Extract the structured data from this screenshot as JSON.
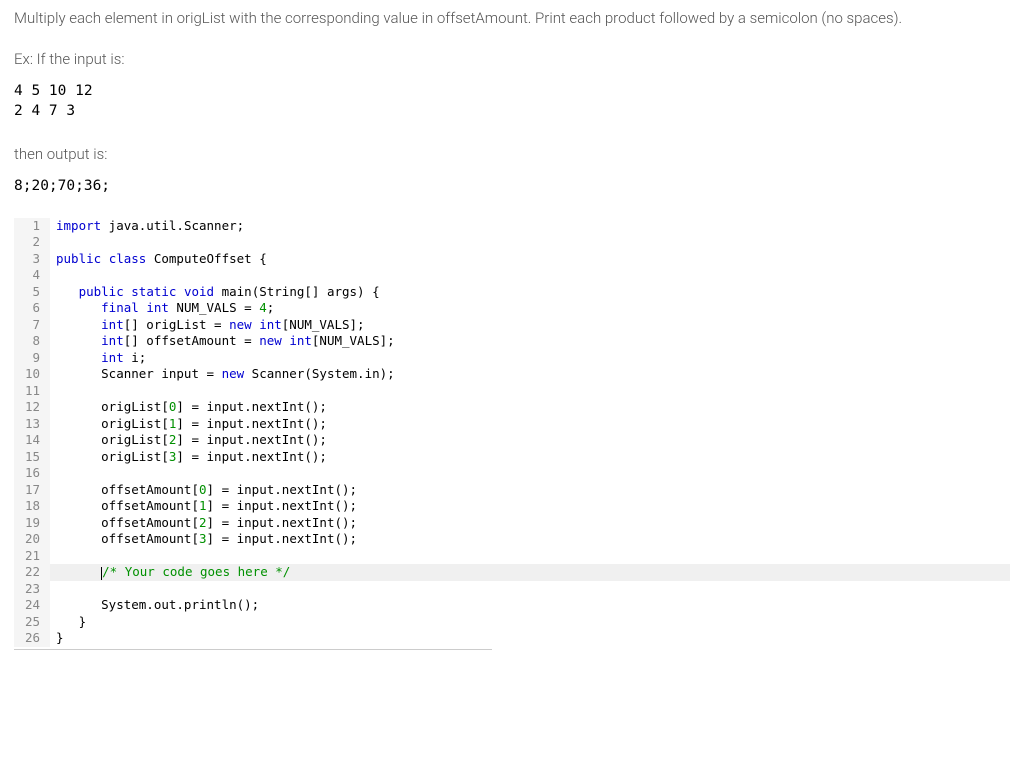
{
  "problem": {
    "instruction": "Multiply each element in origList with the corresponding value in offsetAmount. Print each product followed by a semicolon (no spaces).",
    "input_label": "Ex: If the input is:",
    "input_example": "4 5 10 12\n2 4 7 3",
    "output_label": "then output is:",
    "output_example": "8;20;70;36;"
  },
  "code": {
    "lines": [
      {
        "n": 1,
        "segments": [
          {
            "t": "import",
            "c": "kw"
          },
          {
            "t": " java.util.Scanner;",
            "c": "pkg"
          }
        ]
      },
      {
        "n": 2,
        "segments": []
      },
      {
        "n": 3,
        "segments": [
          {
            "t": "public",
            "c": "kw"
          },
          {
            "t": " ",
            "c": ""
          },
          {
            "t": "class",
            "c": "kw"
          },
          {
            "t": " ComputeOffset {",
            "c": "cls"
          }
        ]
      },
      {
        "n": 4,
        "segments": []
      },
      {
        "n": 5,
        "segments": [
          {
            "t": "   ",
            "c": ""
          },
          {
            "t": "public",
            "c": "kw"
          },
          {
            "t": " ",
            "c": ""
          },
          {
            "t": "static",
            "c": "kw"
          },
          {
            "t": " ",
            "c": ""
          },
          {
            "t": "void",
            "c": "kw"
          },
          {
            "t": " main(String[] args) {",
            "c": "method"
          }
        ]
      },
      {
        "n": 6,
        "segments": [
          {
            "t": "      ",
            "c": ""
          },
          {
            "t": "final",
            "c": "kw"
          },
          {
            "t": " ",
            "c": ""
          },
          {
            "t": "int",
            "c": "kw"
          },
          {
            "t": " NUM_VALS = ",
            "c": "var"
          },
          {
            "t": "4",
            "c": "num"
          },
          {
            "t": ";",
            "c": "punc"
          }
        ]
      },
      {
        "n": 7,
        "segments": [
          {
            "t": "      ",
            "c": ""
          },
          {
            "t": "int",
            "c": "kw"
          },
          {
            "t": "[] origList = ",
            "c": "var"
          },
          {
            "t": "new",
            "c": "kw"
          },
          {
            "t": " ",
            "c": ""
          },
          {
            "t": "int",
            "c": "kw"
          },
          {
            "t": "[NUM_VALS];",
            "c": "var"
          }
        ]
      },
      {
        "n": 8,
        "segments": [
          {
            "t": "      ",
            "c": ""
          },
          {
            "t": "int",
            "c": "kw"
          },
          {
            "t": "[] offsetAmount = ",
            "c": "var"
          },
          {
            "t": "new",
            "c": "kw"
          },
          {
            "t": " ",
            "c": ""
          },
          {
            "t": "int",
            "c": "kw"
          },
          {
            "t": "[NUM_VALS];",
            "c": "var"
          }
        ]
      },
      {
        "n": 9,
        "segments": [
          {
            "t": "      ",
            "c": ""
          },
          {
            "t": "int",
            "c": "kw"
          },
          {
            "t": " i;",
            "c": "var"
          }
        ]
      },
      {
        "n": 10,
        "segments": [
          {
            "t": "      Scanner input = ",
            "c": "var"
          },
          {
            "t": "new",
            "c": "kw"
          },
          {
            "t": " Scanner(System.in);",
            "c": "var"
          }
        ]
      },
      {
        "n": 11,
        "segments": []
      },
      {
        "n": 12,
        "segments": [
          {
            "t": "      origList[",
            "c": "var"
          },
          {
            "t": "0",
            "c": "num"
          },
          {
            "t": "] = input.nextInt();",
            "c": "var"
          }
        ]
      },
      {
        "n": 13,
        "segments": [
          {
            "t": "      origList[",
            "c": "var"
          },
          {
            "t": "1",
            "c": "num"
          },
          {
            "t": "] = input.nextInt();",
            "c": "var"
          }
        ]
      },
      {
        "n": 14,
        "segments": [
          {
            "t": "      origList[",
            "c": "var"
          },
          {
            "t": "2",
            "c": "num"
          },
          {
            "t": "] = input.nextInt();",
            "c": "var"
          }
        ]
      },
      {
        "n": 15,
        "segments": [
          {
            "t": "      origList[",
            "c": "var"
          },
          {
            "t": "3",
            "c": "num"
          },
          {
            "t": "] = input.nextInt();",
            "c": "var"
          }
        ]
      },
      {
        "n": 16,
        "segments": []
      },
      {
        "n": 17,
        "segments": [
          {
            "t": "      offsetAmount[",
            "c": "var"
          },
          {
            "t": "0",
            "c": "num"
          },
          {
            "t": "] = input.nextInt();",
            "c": "var"
          }
        ]
      },
      {
        "n": 18,
        "segments": [
          {
            "t": "      offsetAmount[",
            "c": "var"
          },
          {
            "t": "1",
            "c": "num"
          },
          {
            "t": "] = input.nextInt();",
            "c": "var"
          }
        ]
      },
      {
        "n": 19,
        "segments": [
          {
            "t": "      offsetAmount[",
            "c": "var"
          },
          {
            "t": "2",
            "c": "num"
          },
          {
            "t": "] = input.nextInt();",
            "c": "var"
          }
        ]
      },
      {
        "n": 20,
        "segments": [
          {
            "t": "      offsetAmount[",
            "c": "var"
          },
          {
            "t": "3",
            "c": "num"
          },
          {
            "t": "] = input.nextInt();",
            "c": "var"
          }
        ]
      },
      {
        "n": 21,
        "segments": []
      },
      {
        "n": 22,
        "highlight": true,
        "cursor": true,
        "segments": [
          {
            "t": "      ",
            "c": ""
          },
          {
            "t": "/* Your code goes here */",
            "c": "comment"
          }
        ]
      },
      {
        "n": 23,
        "segments": []
      },
      {
        "n": 24,
        "segments": [
          {
            "t": "      System.out.println();",
            "c": "var"
          }
        ]
      },
      {
        "n": 25,
        "segments": [
          {
            "t": "   }",
            "c": "punc"
          }
        ]
      },
      {
        "n": 26,
        "segments": [
          {
            "t": "}",
            "c": "punc"
          }
        ]
      }
    ]
  }
}
